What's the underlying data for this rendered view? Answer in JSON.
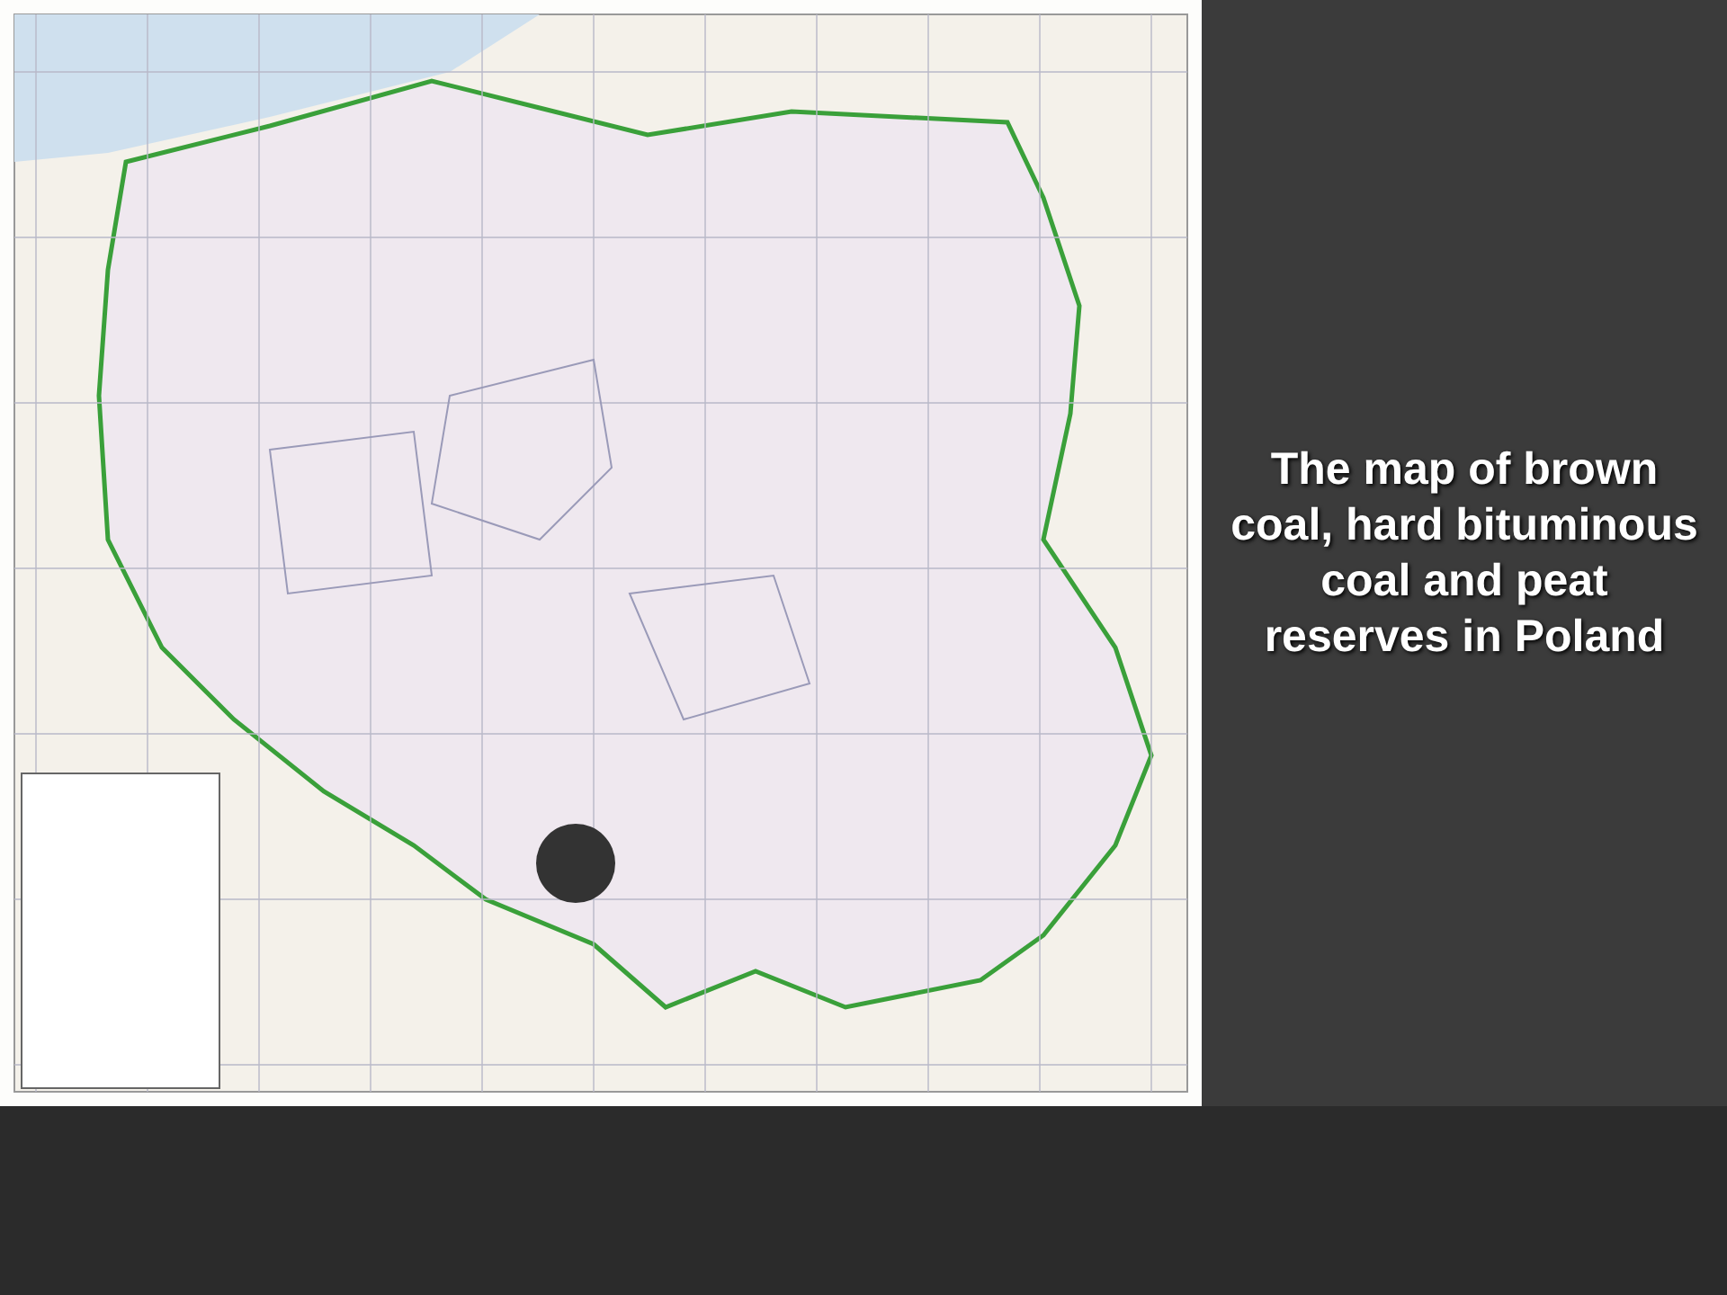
{
  "slide": {
    "caption": "The map of brown coal, hard bituminous coal and peat reserves in Poland"
  }
}
